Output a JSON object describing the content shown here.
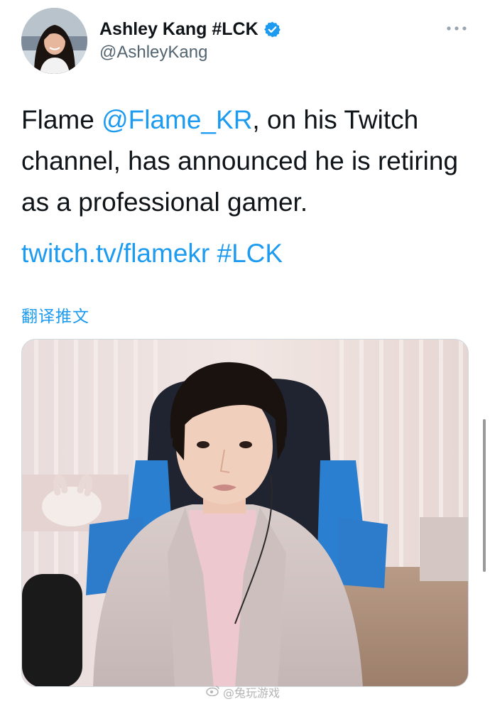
{
  "author": {
    "display_name": "Ashley Kang #LCK",
    "handle": "@AshleyKang",
    "verified_icon": "verified-badge-icon",
    "avatar_icon": "avatar"
  },
  "more_icon": "more-icon",
  "tweet": {
    "text_before": "Flame ",
    "mention": "@Flame_KR",
    "text_after": ", on his Twitch channel, has announced he is retiring as a professional gamer.",
    "link": "twitch.tv/flamekr",
    "hashtag": "#LCK"
  },
  "translate_label": "翻译推文",
  "media": {
    "image_icon": "stream-screenshot-image"
  },
  "watermark": {
    "text": "@兔玩游戏",
    "icon": "weibo-icon"
  },
  "colors": {
    "accent": "#1d9bf0",
    "text": "#0f1419",
    "secondary": "#536471"
  }
}
